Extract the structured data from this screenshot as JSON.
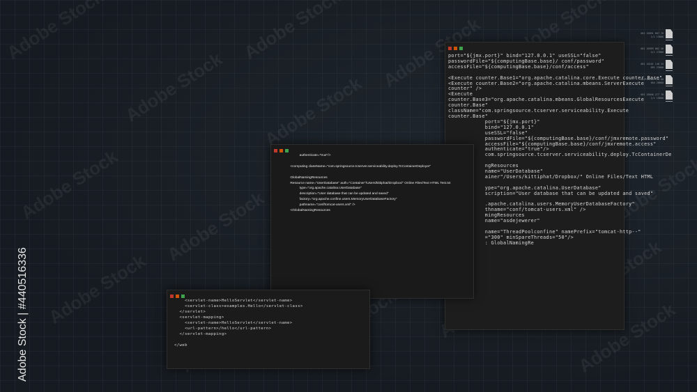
{
  "watermark_text": "Adobe Stock",
  "stock_id": "Adobe Stock | #440516336",
  "colors": {
    "background": "#181e24",
    "window": "#1c1c1c",
    "dot_red": "#c0392b",
    "dot_orange": "#d35400",
    "dot_green": "#3fa34d"
  },
  "windows": {
    "back": {
      "code": "port=\"${jmx.port}\" bind=\"127.0.0.1\" useSSL=\"false\"\npasswordFile=\"${computingBase.base}/ conf/password\"\naccessFile=\"${computingBase.base}/conf/access\"\n\n<Execute counter.Base1=\"org.apache.catalina.core.Execute counter.Base\"\n<Execute counter.Base2=\"org.apache.catalina.mbeans.ServerExecute\ncounter\" />\n<Execute\ncounter.Base3=\"org.apache.catalina.mbeans.GlobalResourcesExecute\ncounter.Base\"\nclassName=\"com.springsource.tcserver.serviceability.Execute\ncounter.Base\"\n            port=\"${jmx.port}\"\n            bind=\"127.0.0.1\"\n            useSSL=\"false\"\n            passwordFile=\"${computingBase.base}/conf/jmxremote.password\"\n            accessFile=\"${computingBase.base}/conf/jmxremote.access\"\n            authenticate=\"true\"/>\n            com.springsource.tcserver.serviceability.deploy.TcContainerDe\n\n            ngResources\n            name=\"UserDatabase\"\n            ainer\"/Users/kittiphat/Dropbox/\" Online Files/Text HTML\n\n            ype=\"org.apache.catalina.UserDatabase\"\n            scription=\"User database that can be updated and saved\"\n\n            .apache.catalina.users.MemoryUserDatabaseFactory\"\n            thname=\"conf/tomcat-users.xml\" />\n            mingResources\n            name=\"asdejewerer\"\n\n            name=\"ThreadPoolconfine\" namePrefix=\"tomcat-http--\"\n            =\"300\" minSpareThreads=\"50\"/>\n            : GlobalNamingRe"
    },
    "middle": {
      "code": "                    authenticate=\"true\"/>\n\n          <computing className=\"com.springsource.tcserver.serviceability.deploy.TcContainerDeployer\"\n\n          GlobalNamingResources\n          Resource name=\"UserDatabase\" auth=\"Container\"/Users/kittiphat/Dropbox/\" Online Files/Text HTML Test.txt\n                    type=\"org.apache.catalina.UserDatabase\"\n                    description=\"User database that can be updated and saved\"\n                    factory=\"org.apache.confine.users.MemoryUserDatabaseFactory\"\n                    pathname=\"conf/tomcat-users.xml\" />\n          </GlobalNamingResources"
    },
    "front": {
      "code": "    <servlet-name>HelloServlet</servlet-name>\n    <servlet-class>examples.Hello</servlet-class>\n  </servlet>\n  <servlet-mapping>\n    <servlet-name>HelloServlet</servlet-name>\n    <url-pattern>/hello</url-pattern>\n  </servlet-mapping>\n\n</web"
    }
  },
  "files": [
    {
      "meta1": "001 20091 687.70",
      "meta2": "1/1 13000"
    },
    {
      "meta1": "001 20093 002 40",
      "meta2": "4/1 27000"
    },
    {
      "meta1": "001 10101 140 15",
      "meta2": "091 23000"
    },
    {
      "meta1": "001 20100 110 60",
      "meta2": "004 20000"
    },
    {
      "meta1": "001 20040 277 70",
      "meta2": "1/1 15000"
    }
  ]
}
